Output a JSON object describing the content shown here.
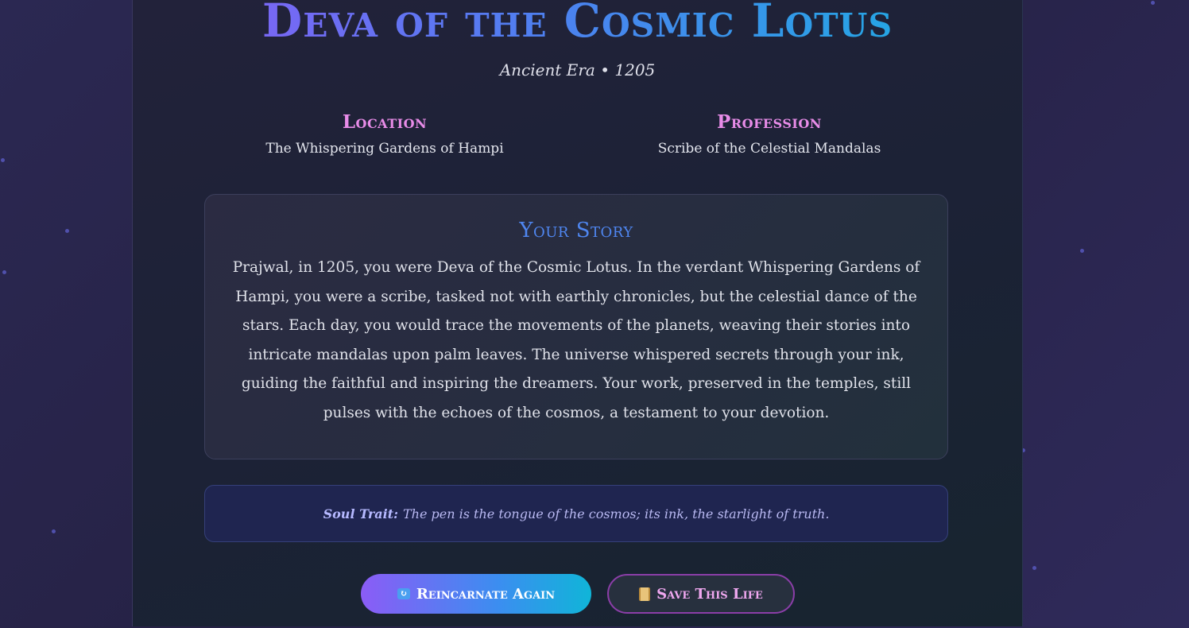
{
  "header": {
    "title": "Deva of the Cosmic Lotus",
    "era": "Ancient Era • 1205"
  },
  "details": {
    "location_label": "Location",
    "location_value": "The Whispering Gardens of Hampi",
    "profession_label": "Profession",
    "profession_value": "Scribe of the Celestial Mandalas"
  },
  "story": {
    "title": "Your Story",
    "text": "Prajwal, in 1205, you were Deva of the Cosmic Lotus. In the verdant Whispering Gardens of Hampi, you were a scribe, tasked not with earthly chronicles, but the celestial dance of the stars. Each day, you would trace the movements of the planets, weaving their stories into intricate mandalas upon palm leaves. The universe whispered secrets through your ink, guiding the faithful and inspiring the dreamers. Your work, preserved in the temples, still pulses with the echoes of the cosmos, a testament to your devotion."
  },
  "trait": {
    "label": "Soul Trait:",
    "text": "The pen is the tongue of the cosmos; its ink, the starlight of truth."
  },
  "actions": {
    "reincarnate_label": "Reincarnate Again",
    "reincarnate_icon": "repeat-icon",
    "save_label": "Save This Life",
    "save_icon": "scroll-icon"
  },
  "colors": {
    "title_gradient_start": "#8b5cf6",
    "title_gradient_end": "#17b2e0",
    "detail_label": "#e88ce8",
    "story_title": "#4f86f0",
    "trait_text": "#b9b9f2"
  }
}
